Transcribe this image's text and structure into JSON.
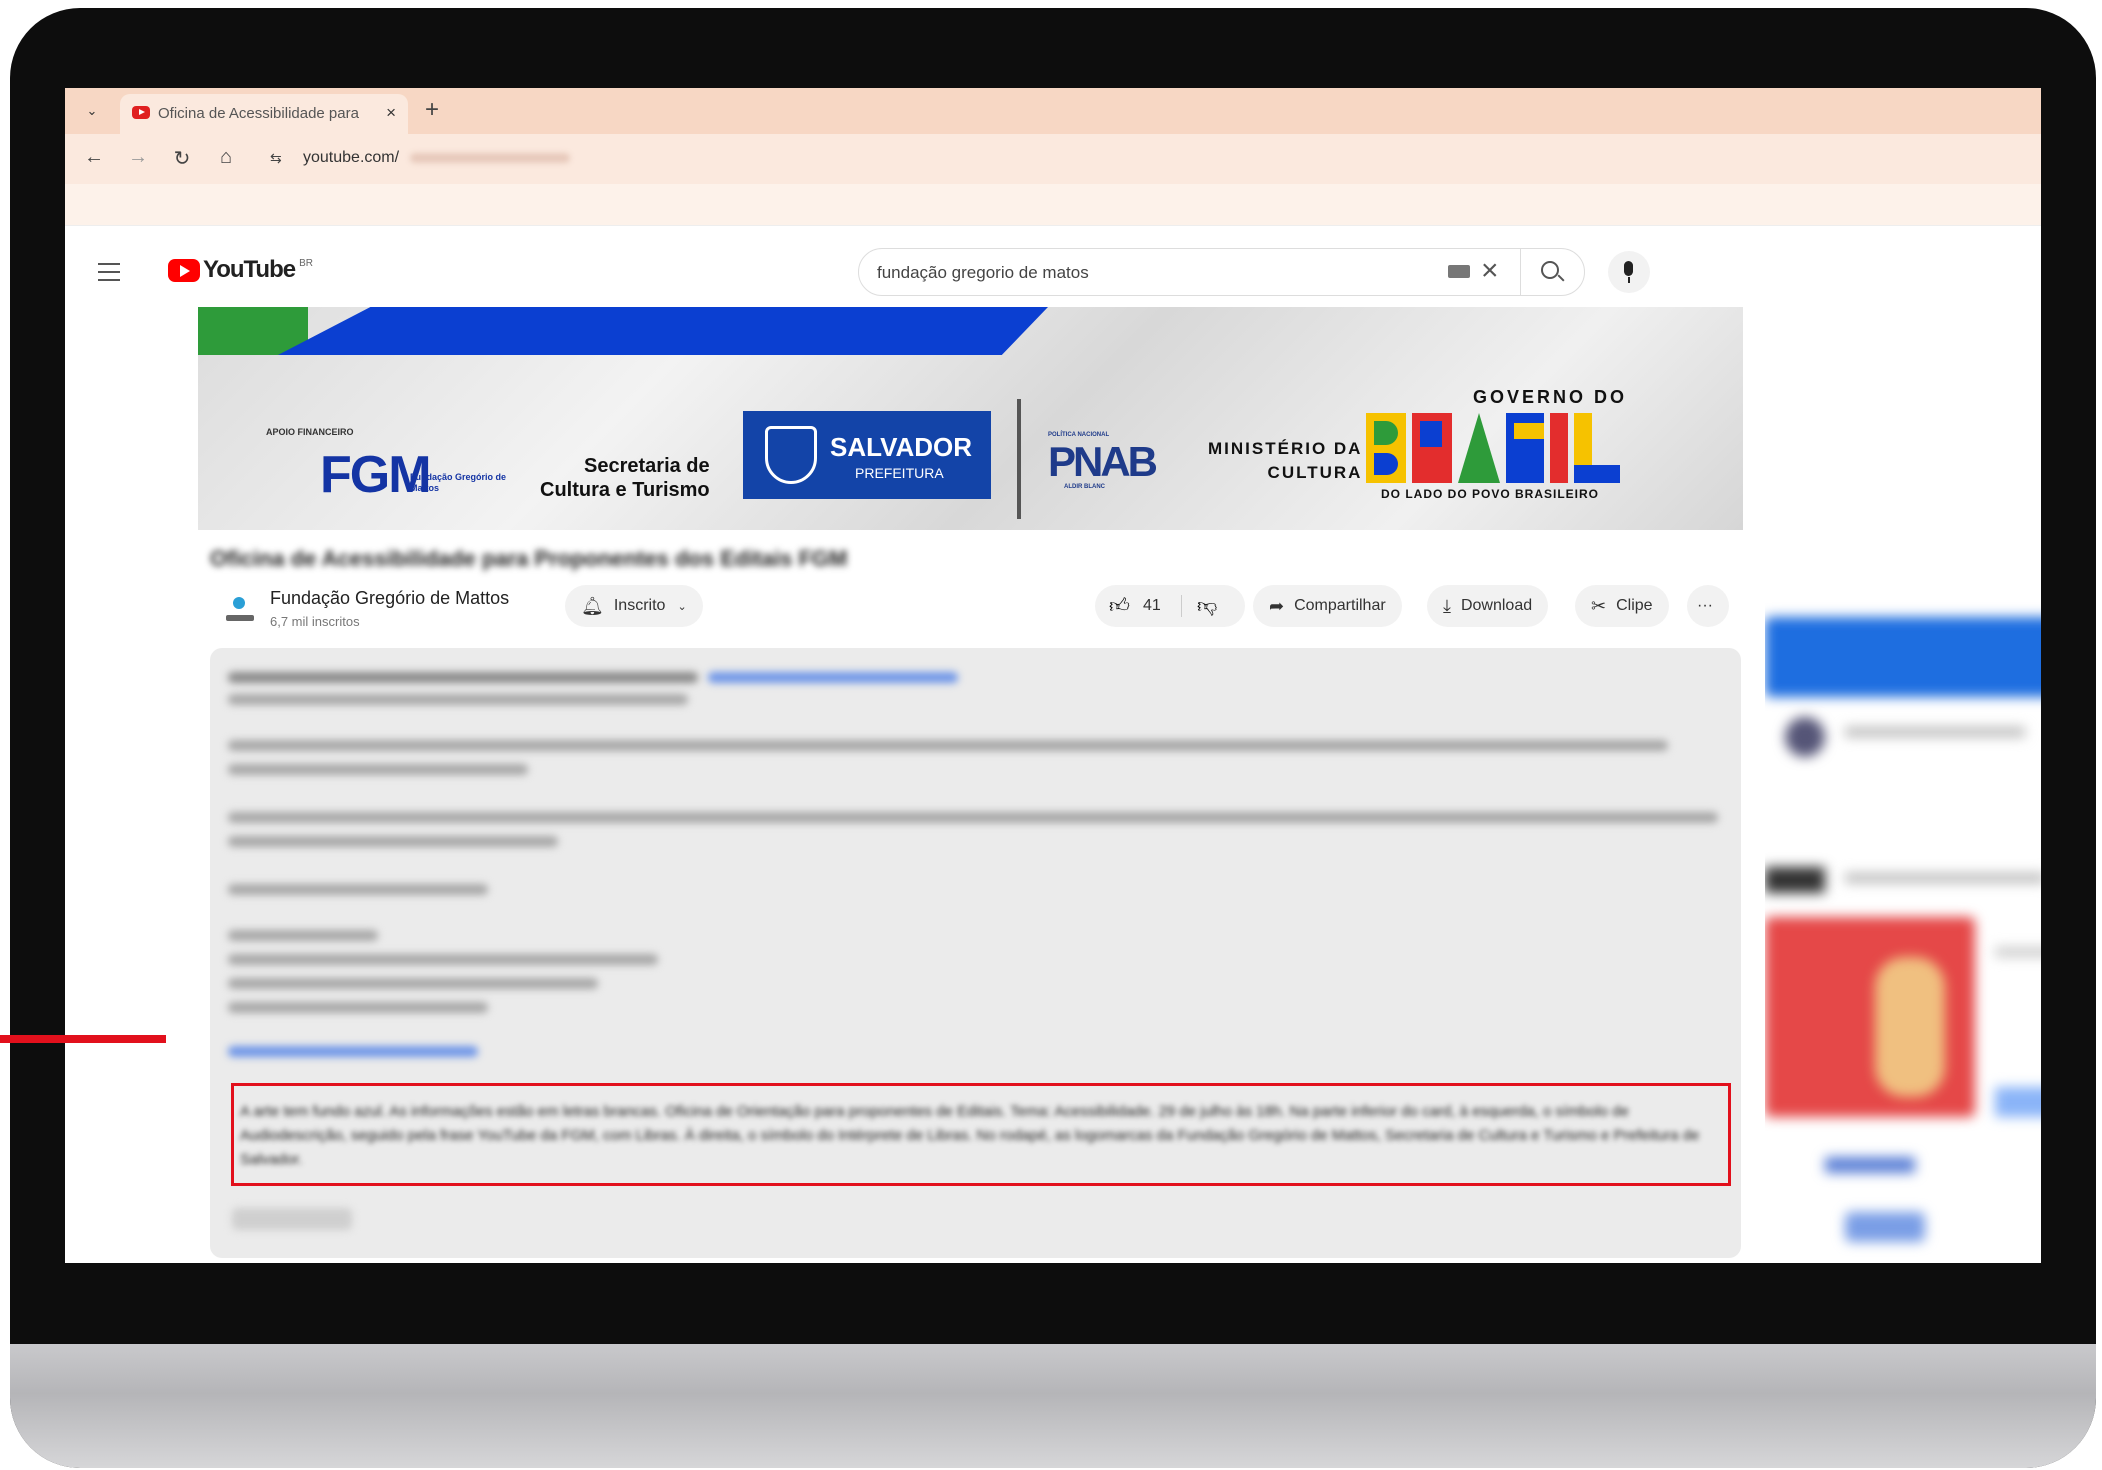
{
  "browser": {
    "tab_title": "Oficina de Acessibilidade para",
    "tab_close": "×",
    "new_tab": "+",
    "url": "youtube.com/",
    "nav": {
      "back": "←",
      "forward": "→",
      "reload": "↻",
      "home": "⌂",
      "site_info": "⇆"
    }
  },
  "youtube": {
    "logo_text": "YouTube",
    "region": "BR",
    "search_query": "fundação gregorio de matos",
    "clear_icon": "×"
  },
  "banner": {
    "apoio": "APOIO FINANCEIRO",
    "fgm": "FGM",
    "fgm_sub": "Fundação Gregório de Mattos",
    "secretaria_l1": "Secretaria de",
    "secretaria_l2": "Cultura e Turismo",
    "salvador": "SALVADOR",
    "prefeitura": "PREFEITURA",
    "pnab_top": "POLÍTICA NACIONAL",
    "pnab": "PNAB",
    "pnab_sub": "ALDIR BLANC",
    "ministerio_l1": "MINISTÉRIO DA",
    "ministerio_l2": "CULTURA",
    "governo": "GOVERNO DO",
    "lado": "DO LADO DO POVO BRASILEIRO",
    "brand_colors": {
      "green": "#2e9b3a",
      "blue": "#0b3fd1",
      "salvador_blue": "#1344a8",
      "yellow": "#f6c200",
      "red": "#e32d2d"
    }
  },
  "video": {
    "title": "Oficina de Acessibilidade para Proponentes dos Editais FGM",
    "channel_name": "Fundação Gregório de Mattos",
    "subscribers": "6,7 mil inscritos",
    "subscribe_label": "Inscrito",
    "likes": "41",
    "share_label": "Compartilhar",
    "download_label": "Download",
    "clip_label": "Clipe",
    "more_label": "···"
  },
  "description": {
    "highlight_text": "A arte tem fundo azul. As informações estão em letras brancas. Oficina de Orientação para proponentes de Editais. Tema: Acessibilidade. 29 de julho às 18h. Na parte inferior do card, à esquerda, o símbolo de Audiodescrição, seguido pela frase YouTube da FGM, com Libras. À direita, o símbolo do Intérprete de Libras. No rodapé, as logomarcas da Fundação Gregório de Mattos, Secretaria de Cultura e Turismo e Prefeitura de Salvador."
  },
  "annotation": {
    "color": "#e2101c"
  }
}
